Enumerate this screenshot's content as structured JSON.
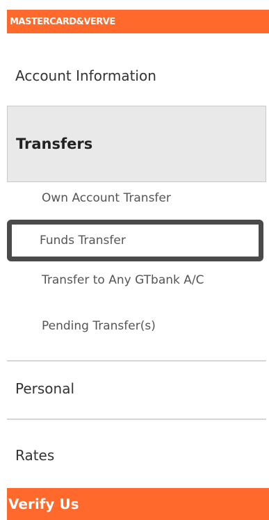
{
  "header": {
    "title": "MASTERCARD&VERVE"
  },
  "menu": {
    "account_information": "Account Information",
    "transfers": "Transfers",
    "transfers_sub": {
      "own_account": "Own Account Transfer",
      "funds": "Funds Transfer",
      "gtbank": "Transfer to Any GTbank A/C",
      "pending": "Pending Transfer(s)"
    },
    "personal": "Personal",
    "rates": "Rates"
  },
  "footer": {
    "verify_us": "Verify Us"
  },
  "colors": {
    "accent": "#ff6a2c",
    "selected_bg": "#e9e9e9",
    "highlight_border": "#4a4a4a"
  }
}
